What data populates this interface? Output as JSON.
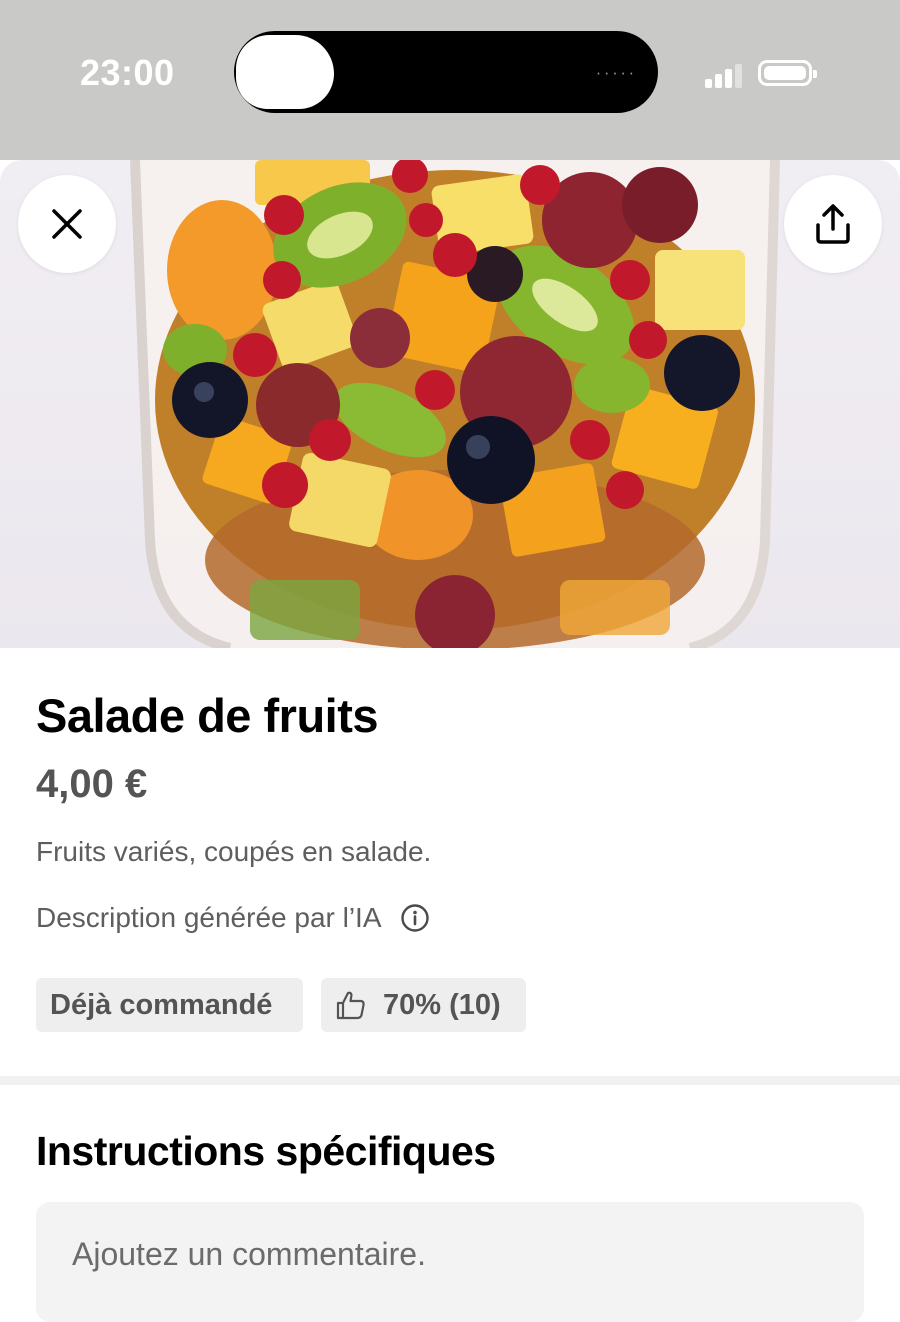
{
  "status_bar": {
    "time": "23:00",
    "island_indicator": "·····",
    "icons": [
      "signal-icon",
      "battery-icon"
    ]
  },
  "hero": {
    "image_subject": "fruit-salad-photo",
    "close_icon": "close-icon",
    "share_icon": "share-icon"
  },
  "product": {
    "title": "Salade de fruits",
    "price": "4,00 €",
    "description": "Fruits variés, coupés en salade.",
    "ai_note": "Description générée par l’IA",
    "ai_note_icon": "info-icon"
  },
  "chips": {
    "ordered": "Déjà commandé",
    "rating_icon": "thumbs-up-icon",
    "rating": "70% (10)"
  },
  "instructions": {
    "title": "Instructions spécifiques",
    "placeholder": "Ajoutez un commentaire."
  },
  "colors": {
    "status_bar_bg": "#c9c9c7",
    "chip_bg": "#eeeeee",
    "secondary_text": "#5e5e5e"
  }
}
